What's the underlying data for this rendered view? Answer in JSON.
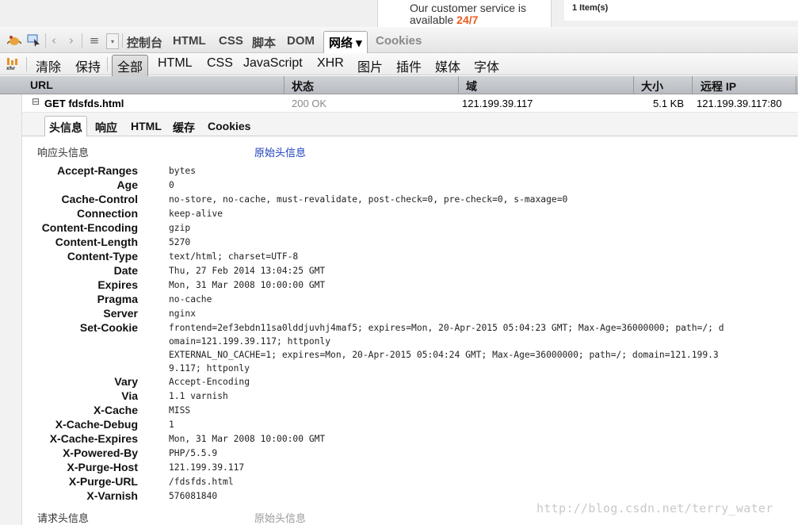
{
  "background_page": {
    "service_text_1": "Our customer service is",
    "service_text_2": "available ",
    "service_highlight": "24/7",
    "items_text": "1 Item(s)"
  },
  "firebug_toolbar": {
    "panels": [
      "控制台",
      "HTML",
      "CSS",
      "脚本",
      "DOM",
      "网络 ▾",
      "Cookies"
    ]
  },
  "net_toolbar": {
    "clear": "清除",
    "persist": "保持",
    "filters": [
      "全部",
      "HTML",
      "CSS",
      "JavaScript",
      "XHR",
      "图片",
      "插件",
      "媒体",
      "字体"
    ]
  },
  "columns": {
    "url": "URL",
    "status": "状态",
    "domain": "域",
    "size": "大小",
    "remote_ip": "远程 IP"
  },
  "request": {
    "toggle": "⊟",
    "url": "GET fdsfds.html",
    "status": "200 OK",
    "domain": "121.199.39.117",
    "size": "5.1 KB",
    "remote_ip": "121.199.39.117:80"
  },
  "detail_tabs": [
    "头信息",
    "响应",
    "HTML",
    "缓存",
    "Cookies"
  ],
  "response_headers": {
    "title": "响应头信息",
    "raw_link": "原始头信息",
    "rows": [
      {
        "name": "Accept-Ranges",
        "value": "bytes"
      },
      {
        "name": "Age",
        "value": "0"
      },
      {
        "name": "Cache-Control",
        "value": "no-store, no-cache, must-revalidate, post-check=0, pre-check=0, s-maxage=0"
      },
      {
        "name": "Connection",
        "value": "keep-alive"
      },
      {
        "name": "Content-Encoding",
        "value": "gzip"
      },
      {
        "name": "Content-Length",
        "value": "5270"
      },
      {
        "name": "Content-Type",
        "value": "text/html; charset=UTF-8"
      },
      {
        "name": "Date",
        "value": "Thu, 27 Feb 2014 13:04:25 GMT"
      },
      {
        "name": "Expires",
        "value": "Mon, 31 Mar 2008 10:00:00 GMT"
      },
      {
        "name": "Pragma",
        "value": "no-cache"
      },
      {
        "name": "Server",
        "value": "nginx"
      },
      {
        "name": "Set-Cookie",
        "value": "frontend=2ef3ebdn11sa0lddjuvhj4maf5; expires=Mon, 20-Apr-2015 05:04:23 GMT; Max-Age=36000000; path=/; domain=121.199.39.117; httponly\nEXTERNAL_NO_CACHE=1; expires=Mon, 20-Apr-2015 05:04:24 GMT; Max-Age=36000000; path=/; domain=121.199.39.117; httponly"
      },
      {
        "name": "Vary",
        "value": "Accept-Encoding"
      },
      {
        "name": "Via",
        "value": "1.1 varnish"
      },
      {
        "name": "X-Cache",
        "value": "MISS"
      },
      {
        "name": "X-Cache-Debug",
        "value": "1"
      },
      {
        "name": "X-Cache-Expires",
        "value": "Mon, 31 Mar 2008 10:00:00 GMT"
      },
      {
        "name": "X-Powered-By",
        "value": "PHP/5.5.9"
      },
      {
        "name": "X-Purge-Host",
        "value": "121.199.39.117"
      },
      {
        "name": "X-Purge-URL",
        "value": "/fdsfds.html"
      },
      {
        "name": "X-Varnish",
        "value": "576081840"
      }
    ]
  },
  "request_headers": {
    "title": "请求头信息",
    "raw_link": "原始头信息"
  },
  "watermark": "http://blog.csdn.net/terry_water"
}
